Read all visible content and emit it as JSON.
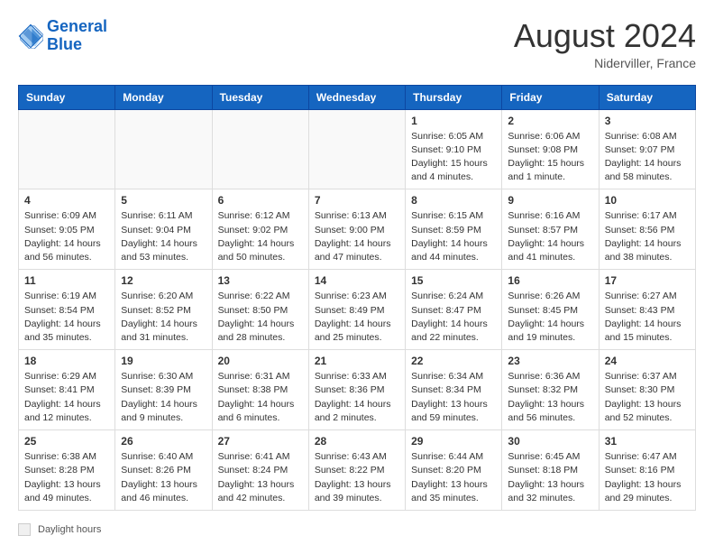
{
  "header": {
    "logo_general": "General",
    "logo_blue": "Blue",
    "month_year": "August 2024",
    "location": "Niderviller, France"
  },
  "days_of_week": [
    "Sunday",
    "Monday",
    "Tuesday",
    "Wednesday",
    "Thursday",
    "Friday",
    "Saturday"
  ],
  "weeks": [
    [
      {
        "day": "",
        "info": ""
      },
      {
        "day": "",
        "info": ""
      },
      {
        "day": "",
        "info": ""
      },
      {
        "day": "",
        "info": ""
      },
      {
        "day": "1",
        "info": "Sunrise: 6:05 AM\nSunset: 9:10 PM\nDaylight: 15 hours and 4 minutes."
      },
      {
        "day": "2",
        "info": "Sunrise: 6:06 AM\nSunset: 9:08 PM\nDaylight: 15 hours and 1 minute."
      },
      {
        "day": "3",
        "info": "Sunrise: 6:08 AM\nSunset: 9:07 PM\nDaylight: 14 hours and 58 minutes."
      }
    ],
    [
      {
        "day": "4",
        "info": "Sunrise: 6:09 AM\nSunset: 9:05 PM\nDaylight: 14 hours and 56 minutes."
      },
      {
        "day": "5",
        "info": "Sunrise: 6:11 AM\nSunset: 9:04 PM\nDaylight: 14 hours and 53 minutes."
      },
      {
        "day": "6",
        "info": "Sunrise: 6:12 AM\nSunset: 9:02 PM\nDaylight: 14 hours and 50 minutes."
      },
      {
        "day": "7",
        "info": "Sunrise: 6:13 AM\nSunset: 9:00 PM\nDaylight: 14 hours and 47 minutes."
      },
      {
        "day": "8",
        "info": "Sunrise: 6:15 AM\nSunset: 8:59 PM\nDaylight: 14 hours and 44 minutes."
      },
      {
        "day": "9",
        "info": "Sunrise: 6:16 AM\nSunset: 8:57 PM\nDaylight: 14 hours and 41 minutes."
      },
      {
        "day": "10",
        "info": "Sunrise: 6:17 AM\nSunset: 8:56 PM\nDaylight: 14 hours and 38 minutes."
      }
    ],
    [
      {
        "day": "11",
        "info": "Sunrise: 6:19 AM\nSunset: 8:54 PM\nDaylight: 14 hours and 35 minutes."
      },
      {
        "day": "12",
        "info": "Sunrise: 6:20 AM\nSunset: 8:52 PM\nDaylight: 14 hours and 31 minutes."
      },
      {
        "day": "13",
        "info": "Sunrise: 6:22 AM\nSunset: 8:50 PM\nDaylight: 14 hours and 28 minutes."
      },
      {
        "day": "14",
        "info": "Sunrise: 6:23 AM\nSunset: 8:49 PM\nDaylight: 14 hours and 25 minutes."
      },
      {
        "day": "15",
        "info": "Sunrise: 6:24 AM\nSunset: 8:47 PM\nDaylight: 14 hours and 22 minutes."
      },
      {
        "day": "16",
        "info": "Sunrise: 6:26 AM\nSunset: 8:45 PM\nDaylight: 14 hours and 19 minutes."
      },
      {
        "day": "17",
        "info": "Sunrise: 6:27 AM\nSunset: 8:43 PM\nDaylight: 14 hours and 15 minutes."
      }
    ],
    [
      {
        "day": "18",
        "info": "Sunrise: 6:29 AM\nSunset: 8:41 PM\nDaylight: 14 hours and 12 minutes."
      },
      {
        "day": "19",
        "info": "Sunrise: 6:30 AM\nSunset: 8:39 PM\nDaylight: 14 hours and 9 minutes."
      },
      {
        "day": "20",
        "info": "Sunrise: 6:31 AM\nSunset: 8:38 PM\nDaylight: 14 hours and 6 minutes."
      },
      {
        "day": "21",
        "info": "Sunrise: 6:33 AM\nSunset: 8:36 PM\nDaylight: 14 hours and 2 minutes."
      },
      {
        "day": "22",
        "info": "Sunrise: 6:34 AM\nSunset: 8:34 PM\nDaylight: 13 hours and 59 minutes."
      },
      {
        "day": "23",
        "info": "Sunrise: 6:36 AM\nSunset: 8:32 PM\nDaylight: 13 hours and 56 minutes."
      },
      {
        "day": "24",
        "info": "Sunrise: 6:37 AM\nSunset: 8:30 PM\nDaylight: 13 hours and 52 minutes."
      }
    ],
    [
      {
        "day": "25",
        "info": "Sunrise: 6:38 AM\nSunset: 8:28 PM\nDaylight: 13 hours and 49 minutes."
      },
      {
        "day": "26",
        "info": "Sunrise: 6:40 AM\nSunset: 8:26 PM\nDaylight: 13 hours and 46 minutes."
      },
      {
        "day": "27",
        "info": "Sunrise: 6:41 AM\nSunset: 8:24 PM\nDaylight: 13 hours and 42 minutes."
      },
      {
        "day": "28",
        "info": "Sunrise: 6:43 AM\nSunset: 8:22 PM\nDaylight: 13 hours and 39 minutes."
      },
      {
        "day": "29",
        "info": "Sunrise: 6:44 AM\nSunset: 8:20 PM\nDaylight: 13 hours and 35 minutes."
      },
      {
        "day": "30",
        "info": "Sunrise: 6:45 AM\nSunset: 8:18 PM\nDaylight: 13 hours and 32 minutes."
      },
      {
        "day": "31",
        "info": "Sunrise: 6:47 AM\nSunset: 8:16 PM\nDaylight: 13 hours and 29 minutes."
      }
    ]
  ],
  "footer": {
    "label": "Daylight hours"
  }
}
